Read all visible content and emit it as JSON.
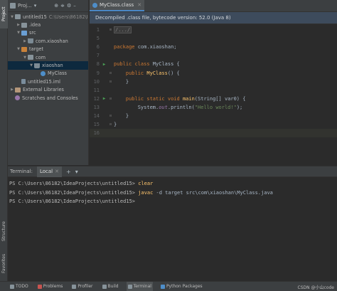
{
  "left_strip": {
    "top_tab": "Project",
    "bottom_tabs": [
      "Structure",
      "Favorites"
    ]
  },
  "project_panel": {
    "title": "Proj...",
    "tree": [
      {
        "label": "untitled15",
        "suffix": "C:\\Users\\86182\\Id",
        "arrow": "▼",
        "icon": "folder",
        "indent": 0
      },
      {
        "label": ".idea",
        "arrow": "▶",
        "icon": "folder",
        "indent": 1
      },
      {
        "label": "src",
        "arrow": "▼",
        "icon": "folder-blue",
        "indent": 1
      },
      {
        "label": "com.xiaoshan",
        "arrow": "▶",
        "icon": "pkg",
        "indent": 2
      },
      {
        "label": "target",
        "arrow": "▼",
        "icon": "folder-orange",
        "indent": 1
      },
      {
        "label": "com",
        "arrow": "▼",
        "icon": "folder",
        "indent": 2
      },
      {
        "label": "xiaoshan",
        "arrow": "▼",
        "icon": "pkg",
        "indent": 3,
        "selected": true
      },
      {
        "label": "MyClass",
        "arrow": "",
        "icon": "cls",
        "indent": 4
      },
      {
        "label": "untitled15.iml",
        "arrow": "",
        "icon": "iml",
        "indent": 1
      },
      {
        "label": "External Libraries",
        "arrow": "▶",
        "icon": "lib",
        "indent": 0
      },
      {
        "label": "Scratches and Consoles",
        "arrow": "",
        "icon": "scratch",
        "indent": 0
      }
    ]
  },
  "editor": {
    "tab_label": "MyClass.class",
    "notice": "Decompiled .class file, bytecode version: 52.0 (Java 8)",
    "lines": [
      {
        "n": "1",
        "segments": [
          {
            "c": "cm",
            "t": "/.../"
          }
        ],
        "fold": "+"
      },
      {
        "n": "5",
        "segments": []
      },
      {
        "n": "6",
        "segments": [
          {
            "c": "kw",
            "t": "package "
          },
          {
            "c": "ct",
            "t": "com.xiaoshan;"
          }
        ]
      },
      {
        "n": "7",
        "segments": []
      },
      {
        "n": "8",
        "run": true,
        "segments": [
          {
            "c": "kw",
            "t": "public class "
          },
          {
            "c": "ct",
            "t": "MyClass {"
          }
        ]
      },
      {
        "n": "9",
        "fold": "-",
        "segments": [
          {
            "c": "ct",
            "t": "    "
          },
          {
            "c": "kw",
            "t": "public "
          },
          {
            "c": "fn",
            "t": "MyClass"
          },
          {
            "c": "ct",
            "t": "() {"
          }
        ]
      },
      {
        "n": "10",
        "fold": "-",
        "segments": [
          {
            "c": "ct",
            "t": "    }"
          }
        ]
      },
      {
        "n": "11",
        "segments": []
      },
      {
        "n": "12",
        "run": true,
        "fold": "-",
        "segments": [
          {
            "c": "ct",
            "t": "    "
          },
          {
            "c": "kw",
            "t": "public static void "
          },
          {
            "c": "fn",
            "t": "main"
          },
          {
            "c": "ct",
            "t": "(String[] var0) {"
          }
        ]
      },
      {
        "n": "13",
        "segments": [
          {
            "c": "ct",
            "t": "        System."
          },
          {
            "c": "fld",
            "t": "out"
          },
          {
            "c": "ct",
            "t": ".println("
          },
          {
            "c": "st",
            "t": "\"Hello world!\""
          },
          {
            "c": "ct",
            "t": ");"
          }
        ]
      },
      {
        "n": "14",
        "fold": "-",
        "segments": [
          {
            "c": "ct",
            "t": "    }"
          }
        ]
      },
      {
        "n": "15",
        "fold": "-",
        "segments": [
          {
            "c": "ct",
            "t": "}"
          }
        ]
      },
      {
        "n": "16",
        "segments": [],
        "highlight": true
      }
    ]
  },
  "terminal": {
    "title": "Terminal:",
    "tab_label": "Local",
    "lines": [
      {
        "prompt": "PS C:\\Users\\86182\\IdeaProjects\\untitled15> ",
        "cmd": "clear",
        "rest": ""
      },
      {
        "prompt": "PS C:\\Users\\86182\\IdeaProjects\\untitled15> ",
        "cmd": "javac",
        "rest": " -d target src\\com\\xiaoshan\\MyClass.java"
      },
      {
        "prompt": "PS C:\\Users\\86182\\IdeaProjects\\untitled15> ",
        "cmd": "",
        "rest": ""
      }
    ]
  },
  "status_bar": {
    "items": [
      {
        "label": "TODO",
        "icon_color": "#87939a"
      },
      {
        "label": "Problems",
        "icon_color": "#c75450"
      },
      {
        "label": "Profiler",
        "icon_color": "#87939a"
      },
      {
        "label": "Build",
        "icon_color": "#87939a"
      },
      {
        "label": "Terminal",
        "icon_color": "#87939a",
        "active": true
      },
      {
        "label": "Python Packages",
        "icon_color": "#4e8ec9"
      }
    ],
    "watermark": "CSDN @小山code"
  }
}
